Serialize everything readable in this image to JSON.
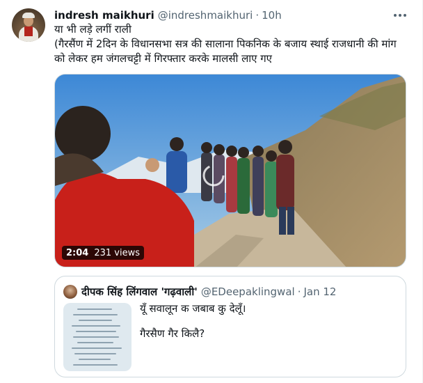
{
  "tweet": {
    "author_name": "indresh maikhuri",
    "author_handle": "@indreshmaikhuri",
    "separator": "·",
    "time": "10h",
    "lines": [
      "या भी लड़े लगीं राली",
      "(गैरसैंण में 2दिन के विधानसभा सत्र की सालाना पिकनिक के बजाय स्थाई राजधानी की मांग",
      "को लेकर हम जंगलचट्टी में गिरफ्तार करके मालसी लाए गए"
    ],
    "more_icon": "more-horizontal-icon"
  },
  "video": {
    "duration": "2:04",
    "views": "231 views",
    "colors": {
      "sky": "#7fb2dc",
      "hill": "#a88f6a",
      "road": "#c7b79b",
      "jacket_red": "#c8201a"
    }
  },
  "quoted_tweet": {
    "author_name": "दीपक सिंह लिंगवाल 'गढ़वाली'",
    "author_handle": "@EDeepaklingwal",
    "separator": "·",
    "time": "Jan 12",
    "text_line1": "यूँ सवालून क जबाब कु देलूँ।",
    "text_line2": "गैरसैण गैर किलै?"
  }
}
